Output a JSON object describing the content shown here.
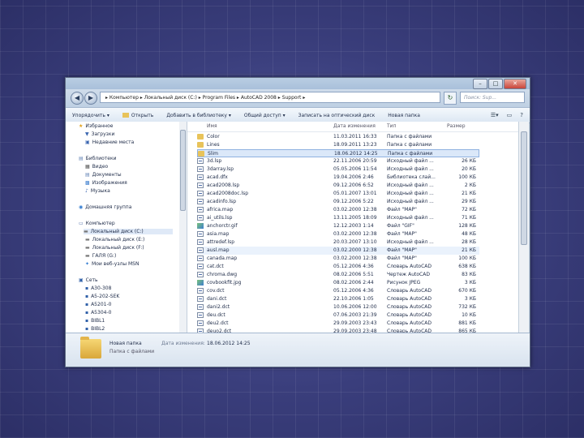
{
  "window": {
    "buttons": {
      "minimize": "–",
      "maximize": "□",
      "close": "✕"
    }
  },
  "address": {
    "path": "▸ Компьютер ▸ Локальный диск (C:) ▸ Program Files ▸ AutoCAD 2008 ▸ Support ▸",
    "search_placeholder": "Поиск: Sup..."
  },
  "toolbar": {
    "organize": "Упорядочить ▾",
    "open": "Открыть",
    "add_library": "Добавить в библиотеку ▾",
    "share": "Общий доступ ▾",
    "burn": "Записать на оптический диск",
    "new_folder": "Новая папка"
  },
  "nav": {
    "favorites": "Избранное",
    "downloads": "Загрузки",
    "recent": "Недавние места",
    "libraries": "Библиотеки",
    "video": "Видео",
    "documents": "Документы",
    "pictures": "Изображения",
    "music": "Музыка",
    "homegroup": "Домашняя группа",
    "computer": "Компьютер",
    "drive_c": "Локальный диск (C:)",
    "drive_e": "Локальный диск (E:)",
    "drive_f": "Локальный диск (F:)",
    "drive_g": "ГАЛЯ (G:)",
    "msn": "Мои веб-узлы MSN",
    "network": "Сеть",
    "net1": "A30-308",
    "net2": "A5-202-SEK",
    "net3": "A5201-0",
    "net4": "A5304-0",
    "net5": "BIBL1",
    "net6": "BIBL2"
  },
  "columns": {
    "name": "Имя",
    "date": "Дата изменения",
    "type": "Тип",
    "size": "Размер"
  },
  "files": [
    {
      "name": "Color",
      "date": "11.03.2011 16:33",
      "type": "Папка с файлами",
      "size": "",
      "icon": "folder"
    },
    {
      "name": "Lines",
      "date": "18.09.2011 13:23",
      "type": "Папка с файлами",
      "size": "",
      "icon": "folder"
    },
    {
      "name": "Slim",
      "date": "18.06.2012 14:25",
      "type": "Папка с файлами",
      "size": "",
      "icon": "folder"
    },
    {
      "name": "3d.lsp",
      "date": "22.11.2006 20:59",
      "type": "Исходный файл ...",
      "size": "26 КБ",
      "icon": "doc"
    },
    {
      "name": "3darray.lsp",
      "date": "05.05.2006 11:54",
      "type": "Исходный файл ...",
      "size": "20 КБ",
      "icon": "doc"
    },
    {
      "name": "acad.dfx",
      "date": "19.04.2006 2:46",
      "type": "Библиотека слай...",
      "size": "100 КБ",
      "icon": "doc"
    },
    {
      "name": "acad2008.lsp",
      "date": "09.12.2006 6:52",
      "type": "Исходный файл ...",
      "size": "2 КБ",
      "icon": "doc"
    },
    {
      "name": "acad2008doc.lsp",
      "date": "05.01.2007 13:01",
      "type": "Исходный файл ...",
      "size": "21 КБ",
      "icon": "doc"
    },
    {
      "name": "acadinfo.lsp",
      "date": "09.12.2006 5:22",
      "type": "Исходный файл ...",
      "size": "29 КБ",
      "icon": "doc"
    },
    {
      "name": "africa.map",
      "date": "03.02.2000 12:38",
      "type": "Файл \"MAP\"",
      "size": "72 КБ",
      "icon": "doc"
    },
    {
      "name": "ai_utils.lsp",
      "date": "13.11.2005 18:09",
      "type": "Исходный файл ...",
      "size": "71 КБ",
      "icon": "doc"
    },
    {
      "name": "anchorctr.gif",
      "date": "12.12.2003 1:14",
      "type": "Файл \"GIF\"",
      "size": "128 КБ",
      "icon": "img"
    },
    {
      "name": "asia.map",
      "date": "03.02.2000 12:38",
      "type": "Файл \"MAP\"",
      "size": "48 КБ",
      "icon": "doc"
    },
    {
      "name": "attredef.lsp",
      "date": "20.03.2007 13:10",
      "type": "Исходный файл ...",
      "size": "28 КБ",
      "icon": "doc"
    },
    {
      "name": "ausl.map",
      "date": "03.02.2000 12:38",
      "type": "Файл \"MAP\"",
      "size": "21 КБ",
      "icon": "doc"
    },
    {
      "name": "canada.map",
      "date": "03.02.2000 12:38",
      "type": "Файл \"MAP\"",
      "size": "100 КБ",
      "icon": "doc"
    },
    {
      "name": "cat.dct",
      "date": "05.12.2006 4:36",
      "type": "Словарь AutoCAD",
      "size": "638 КБ",
      "icon": "doc"
    },
    {
      "name": "chroma.dwg",
      "date": "08.02.2006 5:51",
      "type": "Чертеж AutoCAD",
      "size": "83 КБ",
      "icon": "doc"
    },
    {
      "name": "covbookfit.jpg",
      "date": "08.02.2006 2:44",
      "type": "Рисунок JPEG",
      "size": "3 КБ",
      "icon": "img"
    },
    {
      "name": "cov.dct",
      "date": "05.12.2006 4:36",
      "type": "Словарь AutoCAD",
      "size": "670 КБ",
      "icon": "doc"
    },
    {
      "name": "dani.dct",
      "date": "22.10.2006 1:05",
      "type": "Словарь AutoCAD",
      "size": "3 КБ",
      "icon": "doc"
    },
    {
      "name": "dani2.dct",
      "date": "10.06.2006 12:00",
      "type": "Словарь AutoCAD",
      "size": "732 КБ",
      "icon": "doc"
    },
    {
      "name": "deu.dct",
      "date": "07.06.2003 21:39",
      "type": "Словарь AutoCAD",
      "size": "10 КБ",
      "icon": "doc"
    },
    {
      "name": "deu2.dct",
      "date": "29.09.2003 23:43",
      "type": "Словарь AutoCAD",
      "size": "881 КБ",
      "icon": "doc"
    },
    {
      "name": "deuo2.dct",
      "date": "29.09.2003 23:48",
      "type": "Словарь AutoCAD",
      "size": "865 КБ",
      "icon": "doc"
    }
  ],
  "details": {
    "name": "Новая папка",
    "type": "Папка с файлами",
    "date_label": "Дата изменения:",
    "date_value": "18.06.2012 14:25"
  }
}
